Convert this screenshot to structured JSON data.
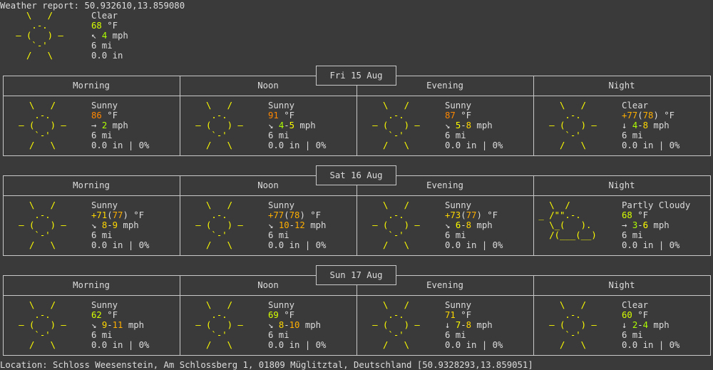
{
  "header": {
    "report_label": "Weather report: 50.932610,13.859080",
    "current": {
      "condition": "Clear",
      "temp": "68",
      "temp_unit": " °F",
      "wind_arrow": "↖",
      "wind": "4",
      "wind_unit": " mph",
      "visibility": "6 mi",
      "precip": "0.0 in"
    }
  },
  "period_labels": [
    "Morning",
    "Noon",
    "Evening",
    "Night"
  ],
  "days": [
    {
      "date": "Fri 15 Aug",
      "periods": [
        {
          "condition": "Sunny",
          "temp_prefix": "",
          "temp": "86",
          "temp_feels": "",
          "temp_unit": " °F",
          "wind_arrow": "→",
          "wind": "2",
          "wind_unit": " mph",
          "visibility": "6 mi",
          "precip": "0.0 in | 0%"
        },
        {
          "condition": "Sunny",
          "temp_prefix": "",
          "temp": "91",
          "temp_feels": "",
          "temp_unit": " °F",
          "wind_arrow": "↘",
          "wind": "4-5",
          "wind_unit": " mph",
          "visibility": "6 mi",
          "precip": "0.0 in | 0%"
        },
        {
          "condition": "Sunny",
          "temp_prefix": "",
          "temp": "87",
          "temp_feels": "",
          "temp_unit": " °F",
          "wind_arrow": "↘",
          "wind": "5-8",
          "wind_unit": " mph",
          "visibility": "6 mi",
          "precip": "0.0 in | 0%"
        },
        {
          "condition": "Clear",
          "temp_prefix": "+",
          "temp": "77",
          "temp_feels": "78",
          "temp_unit": " °F",
          "wind_arrow": "↓",
          "wind": "4-8",
          "wind_unit": " mph",
          "visibility": "6 mi",
          "precip": "0.0 in | 0%"
        }
      ]
    },
    {
      "date": "Sat 16 Aug",
      "periods": [
        {
          "condition": "Sunny",
          "temp_prefix": "+",
          "temp": "71",
          "temp_feels": "77",
          "temp_unit": " °F",
          "wind_arrow": "↘",
          "wind": "8-9",
          "wind_unit": " mph",
          "visibility": "6 mi",
          "precip": "0.0 in | 0%"
        },
        {
          "condition": "Sunny",
          "temp_prefix": "+",
          "temp": "77",
          "temp_feels": "78",
          "temp_unit": " °F",
          "wind_arrow": "↘",
          "wind": "10-12",
          "wind_unit": " mph",
          "visibility": "6 mi",
          "precip": "0.0 in | 0%"
        },
        {
          "condition": "Sunny",
          "temp_prefix": "+",
          "temp": "73",
          "temp_feels": "77",
          "temp_unit": " °F",
          "wind_arrow": "↘",
          "wind": "6-8",
          "wind_unit": " mph",
          "visibility": "6 mi",
          "precip": "0.0 in | 0%"
        },
        {
          "condition": "Partly Cloudy",
          "temp_prefix": "",
          "temp": "68",
          "temp_feels": "",
          "temp_unit": " °F",
          "wind_arrow": "→",
          "wind": "3-6",
          "wind_unit": " mph",
          "visibility": "6 mi",
          "precip": "0.0 in | 0%"
        }
      ]
    },
    {
      "date": "Sun 17 Aug",
      "periods": [
        {
          "condition": "Sunny",
          "temp_prefix": "",
          "temp": "62",
          "temp_feels": "",
          "temp_unit": " °F",
          "wind_arrow": "↘",
          "wind": "9-11",
          "wind_unit": " mph",
          "visibility": "6 mi",
          "precip": "0.0 in | 0%"
        },
        {
          "condition": "Sunny",
          "temp_prefix": "",
          "temp": "69",
          "temp_feels": "",
          "temp_unit": " °F",
          "wind_arrow": "↘",
          "wind": "8-10",
          "wind_unit": " mph",
          "visibility": "6 mi",
          "precip": "0.0 in | 0%"
        },
        {
          "condition": "Sunny",
          "temp_prefix": "",
          "temp": "71",
          "temp_feels": "",
          "temp_unit": " °F",
          "wind_arrow": "↓",
          "wind": "7-8",
          "wind_unit": " mph",
          "visibility": "6 mi",
          "precip": "0.0 in | 0%"
        },
        {
          "condition": "Clear",
          "temp_prefix": "",
          "temp": "60",
          "temp_feels": "",
          "temp_unit": " °F",
          "wind_arrow": "↓",
          "wind": "2-4",
          "wind_unit": " mph",
          "visibility": "6 mi",
          "precip": "0.0 in | 0%"
        }
      ]
    }
  ],
  "footer": {
    "location": "Location: Schloss Weesenstein, Am Schlossberg 1, 01809 Müglitztal, Deutschland [50.9328293,13.859051]"
  }
}
